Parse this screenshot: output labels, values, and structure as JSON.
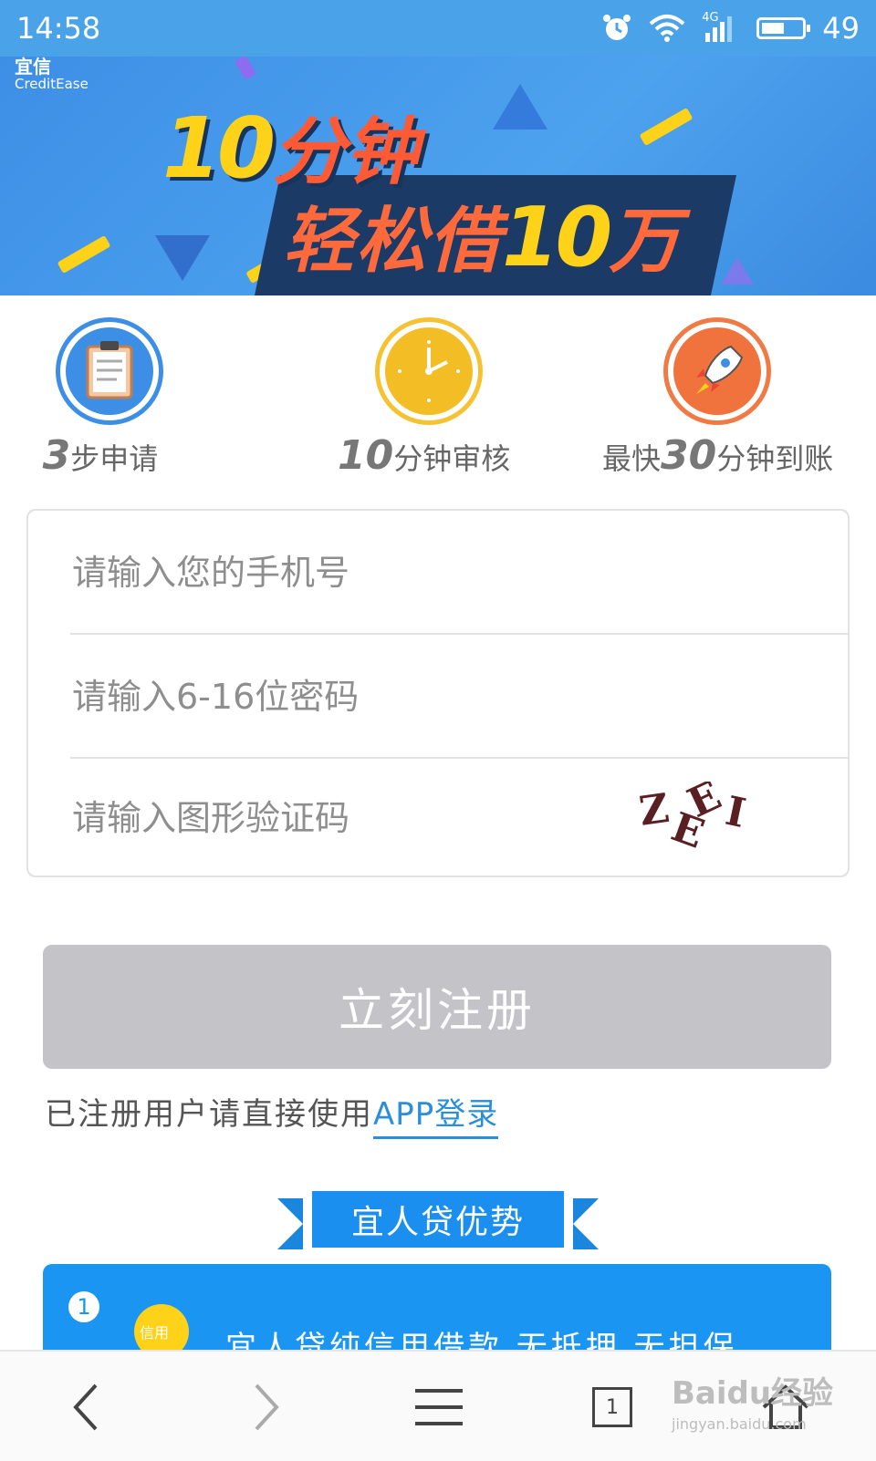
{
  "status_bar": {
    "time": "14:58",
    "network": "4G",
    "battery": "49",
    "icons": [
      "alarm-icon",
      "wifi-icon",
      "signal-icon",
      "battery-icon"
    ]
  },
  "banner": {
    "brand_en": "CreditEase",
    "brand_cn": "宜信",
    "line1_num": "10",
    "line1_text": "分钟",
    "line2_text": "轻松借",
    "line2_num": "10",
    "line2_unit": "万"
  },
  "features": [
    {
      "icon": "clipboard-icon",
      "big": "3",
      "text": "步申请"
    },
    {
      "icon": "clock-icon",
      "big": "10",
      "text": "分钟审核"
    },
    {
      "icon": "rocket-icon",
      "prefix": "最快",
      "big": "30",
      "text": "分钟到账"
    }
  ],
  "form": {
    "phone_placeholder": "请输入您的手机号",
    "password_placeholder": "请输入6-16位密码",
    "captcha_placeholder": "请输入图形验证码",
    "captcha_text": "ZEEI"
  },
  "register_button": "立刻注册",
  "login_prompt": "已注册用户请直接使用",
  "login_link": "APP登录",
  "advantages": {
    "title": "宜人贷优势",
    "item_number": "1",
    "item_badge": "信用",
    "item_text": "宜人贷纯信用借款 无抵押 无担保"
  },
  "browser_bar": {
    "tab_count": "1",
    "icons": [
      "back-icon",
      "forward-icon",
      "menu-icon",
      "tabs-icon",
      "home-icon"
    ]
  },
  "watermark": {
    "text": "Baidu经验",
    "sub": "jingyan.baidu.com"
  },
  "colors": {
    "accent_blue": "#4aa3e8",
    "link_blue": "#2a8fd8",
    "button_disabled": "#c4c3c8",
    "ribbon_blue": "#1a8ff0"
  }
}
